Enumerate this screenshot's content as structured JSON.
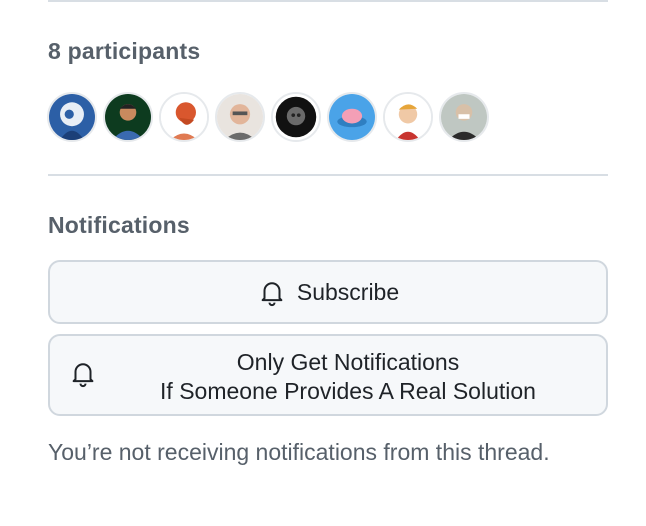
{
  "participants": {
    "title": "8 participants",
    "avatars": [
      {
        "name": "avatar-1"
      },
      {
        "name": "avatar-2"
      },
      {
        "name": "avatar-3"
      },
      {
        "name": "avatar-4"
      },
      {
        "name": "avatar-5"
      },
      {
        "name": "avatar-6"
      },
      {
        "name": "avatar-7"
      },
      {
        "name": "avatar-8"
      }
    ]
  },
  "notifications": {
    "title": "Notifications",
    "subscribe_label": "Subscribe",
    "solution_line1": "Only Get Notifications",
    "solution_line2": "If Someone Provides A Real Solution",
    "bell_icon": "bell-icon",
    "status": "You’re not receiving notifications from this thread."
  },
  "colors": {
    "muted_text": "#57606a",
    "button_bg": "#f6f8fa",
    "button_border": "#d0d7de",
    "divider": "#d8dee4"
  }
}
